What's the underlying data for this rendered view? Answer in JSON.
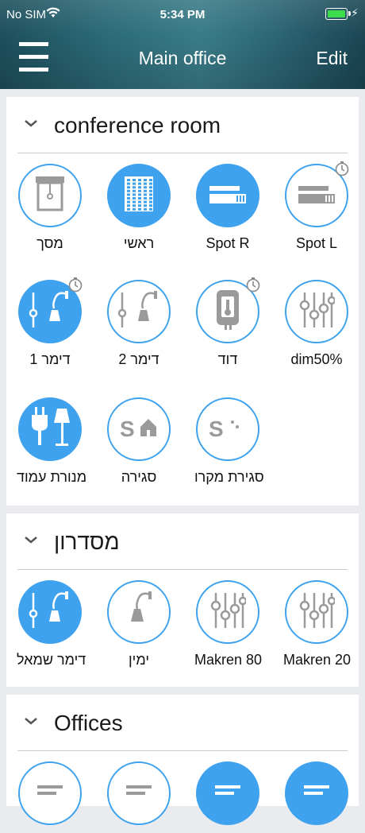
{
  "status": {
    "carrier": "No SIM",
    "time": "5:34 PM"
  },
  "header": {
    "title": "Main office",
    "edit_label": "Edit"
  },
  "sections": [
    {
      "title": "conference room",
      "devices": [
        {
          "label": "מסך",
          "icon": "screen-icon",
          "on": false
        },
        {
          "label": "ראשי",
          "icon": "main-panel-icon",
          "on": true
        },
        {
          "label": "Spot R",
          "icon": "spot-light-icon",
          "on": true
        },
        {
          "label": "Spot L",
          "icon": "spot-light-icon",
          "on": false,
          "timer": true
        },
        {
          "label": "דימר 1",
          "icon": "wall-lamp-dimmer-icon",
          "on": true,
          "timer": true
        },
        {
          "label": "דימר 2",
          "icon": "wall-lamp-dimmer-icon",
          "on": false
        },
        {
          "label": "דוד",
          "icon": "water-heater-icon",
          "on": false,
          "timer": true
        },
        {
          "label": "dim50%",
          "icon": "sliders-icon",
          "on": false
        },
        {
          "label": "מנורת עמוד",
          "icon": "plug-lamp-icon",
          "on": true
        },
        {
          "label": "סגירה",
          "icon": "scene-home-icon",
          "on": false
        },
        {
          "label": "סגירת מקרו",
          "icon": "scene-night-icon",
          "on": false
        }
      ]
    },
    {
      "title": "מסדרון",
      "devices": [
        {
          "label": "דימר שמאל",
          "icon": "wall-lamp-dimmer-icon",
          "on": true
        },
        {
          "label": "ימין",
          "icon": "wall-lamp-icon",
          "on": false
        },
        {
          "label": "Makren 80",
          "icon": "sliders-icon",
          "on": false
        },
        {
          "label": "Makren 20",
          "icon": "sliders-icon",
          "on": false
        }
      ]
    },
    {
      "title": "Offices",
      "devices": [
        {
          "label": "",
          "icon": "device-icon",
          "on": false
        },
        {
          "label": "",
          "icon": "device-icon",
          "on": false
        },
        {
          "label": "",
          "icon": "device-icon",
          "on": true
        },
        {
          "label": "",
          "icon": "device-icon",
          "on": true
        }
      ]
    }
  ],
  "colors": {
    "accent": "#3ea2ee",
    "icon_gray": "#9a9a9a"
  }
}
